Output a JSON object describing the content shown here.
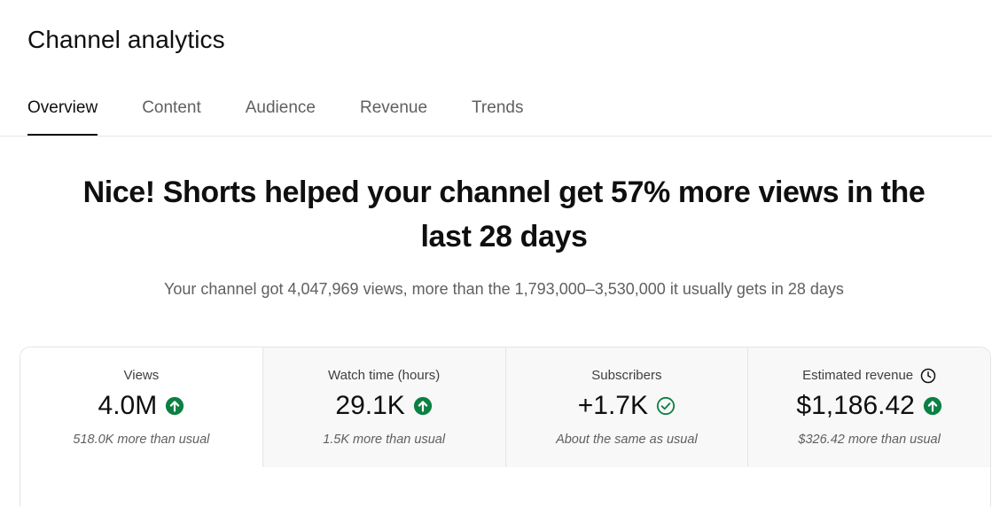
{
  "header": {
    "title": "Channel analytics"
  },
  "tabs": [
    {
      "label": "Overview",
      "active": true
    },
    {
      "label": "Content",
      "active": false
    },
    {
      "label": "Audience",
      "active": false
    },
    {
      "label": "Revenue",
      "active": false
    },
    {
      "label": "Trends",
      "active": false
    }
  ],
  "summary": {
    "headline_line1": "Nice! Shorts helped your channel get 57% more views in the",
    "headline_line2": "last 28 days",
    "subline": "Your channel got 4,047,969 views, more than the 1,793,000–3,530,000 it usually gets in 28 days"
  },
  "metrics": [
    {
      "label": "Views",
      "value": "4.0M",
      "trend_icon": "arrow-up-circle-icon",
      "note": "518.0K more than usual"
    },
    {
      "label": "Watch time (hours)",
      "value": "29.1K",
      "trend_icon": "arrow-up-circle-icon",
      "note": "1.5K more than usual"
    },
    {
      "label": "Subscribers",
      "value": "+1.7K",
      "trend_icon": "check-circle-icon",
      "note": "About the same as usual"
    },
    {
      "label": "Estimated revenue",
      "label_icon": "clock-icon",
      "value": "$1,186.42",
      "trend_icon": "arrow-up-circle-icon",
      "note": "$326.42 more than usual"
    }
  ],
  "colors": {
    "positive": "#0b8043",
    "text_primary": "#0f0f0f",
    "text_secondary": "#606060"
  }
}
